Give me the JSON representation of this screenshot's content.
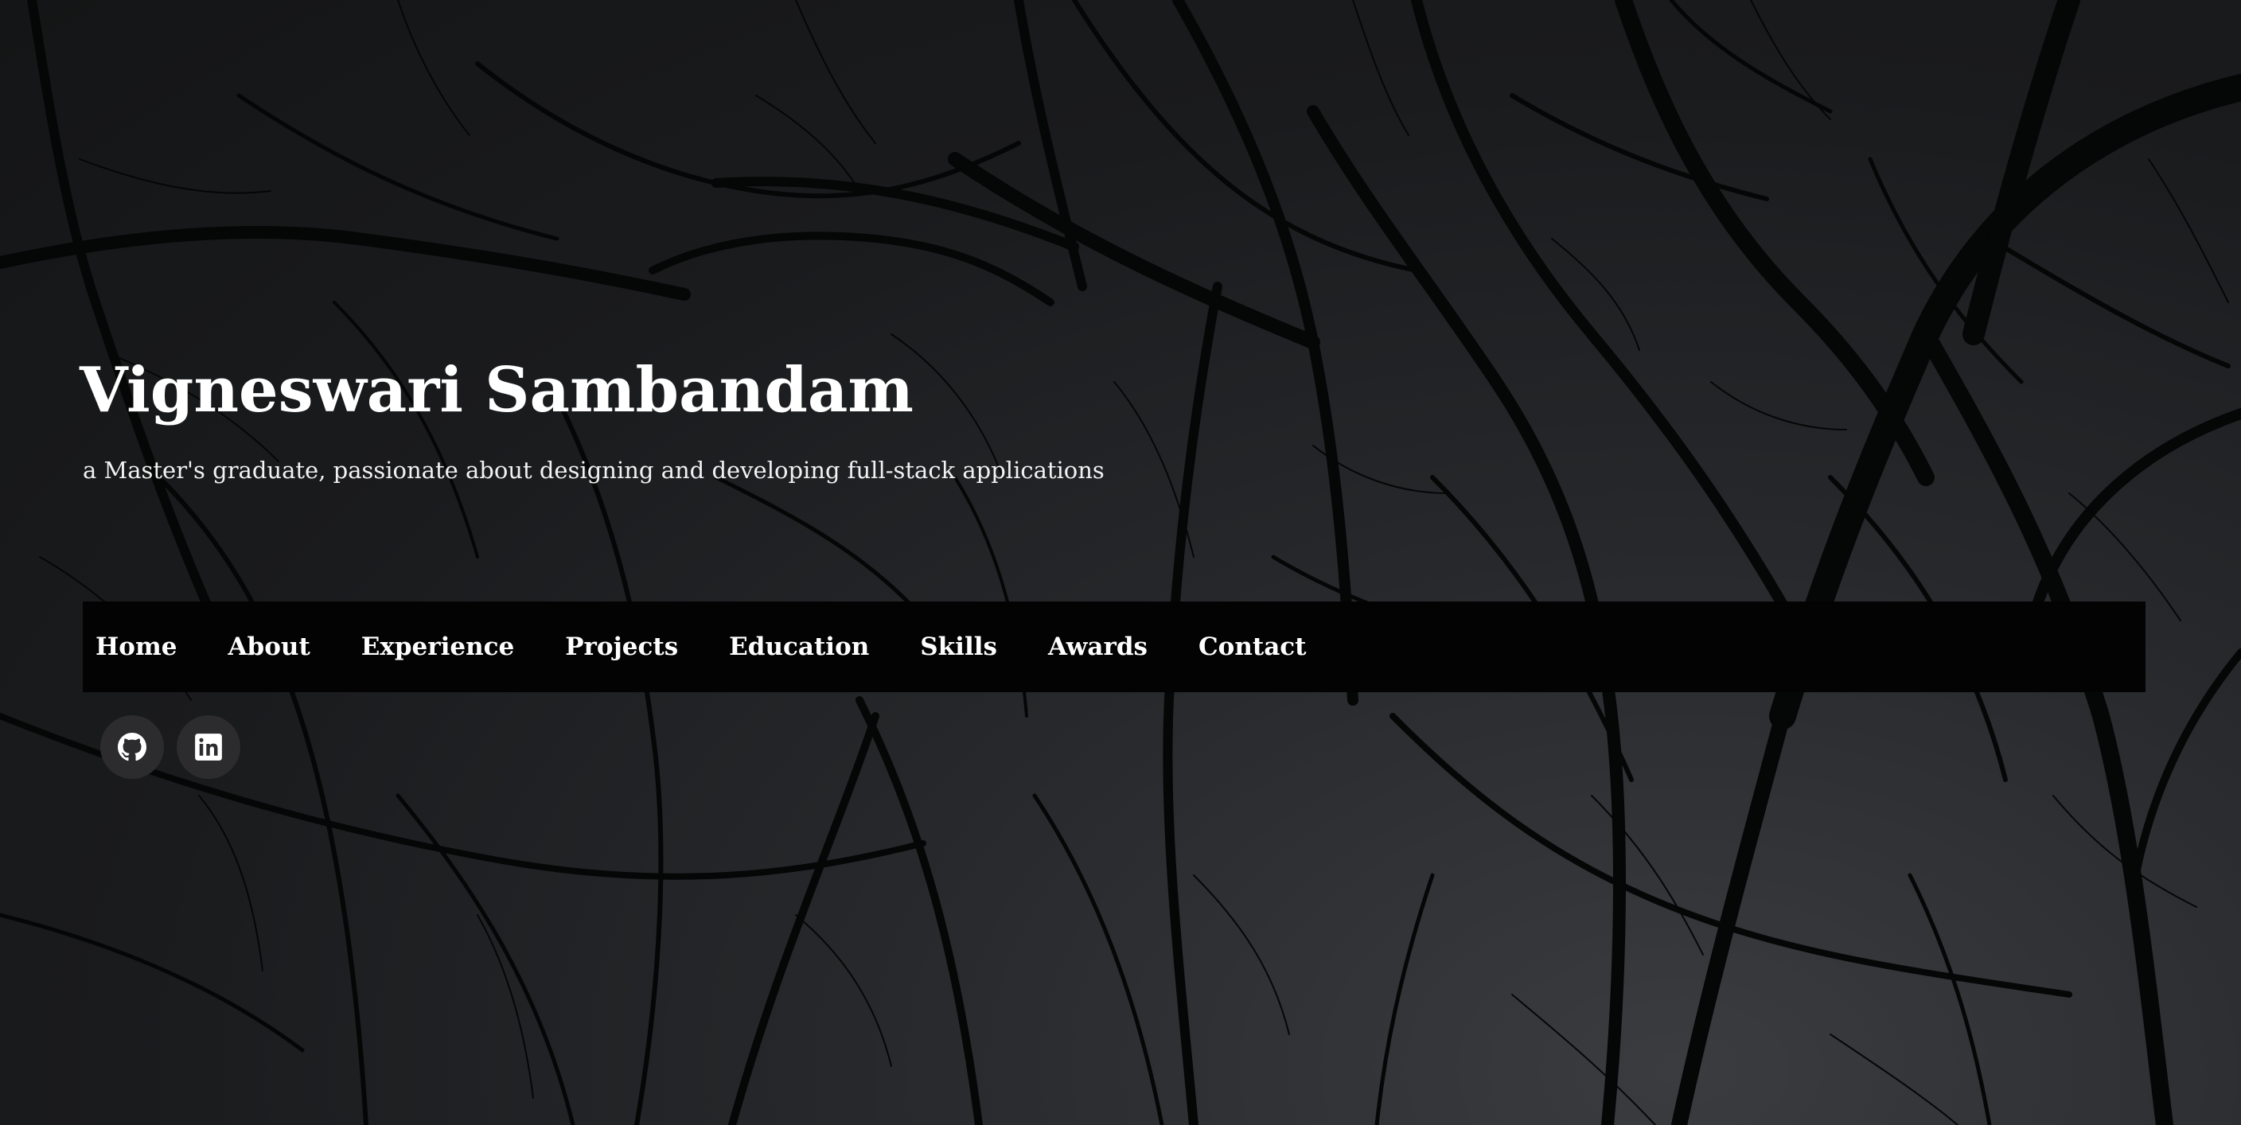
{
  "header": {
    "name": "Vigneswari Sambandam",
    "tagline": "a Master's graduate, passionate about designing and developing full-stack applications"
  },
  "nav": {
    "items": [
      {
        "label": "Home"
      },
      {
        "label": "About"
      },
      {
        "label": "Experience"
      },
      {
        "label": "Projects"
      },
      {
        "label": "Education"
      },
      {
        "label": "Skills"
      },
      {
        "label": "Awards"
      },
      {
        "label": "Contact"
      }
    ]
  },
  "socials": [
    {
      "icon": "github-icon"
    },
    {
      "icon": "linkedin-icon"
    }
  ],
  "colors": {
    "background": "#161718",
    "nav_background": "#030303",
    "text": "#ffffff",
    "social_button": "#2c2c2e"
  }
}
